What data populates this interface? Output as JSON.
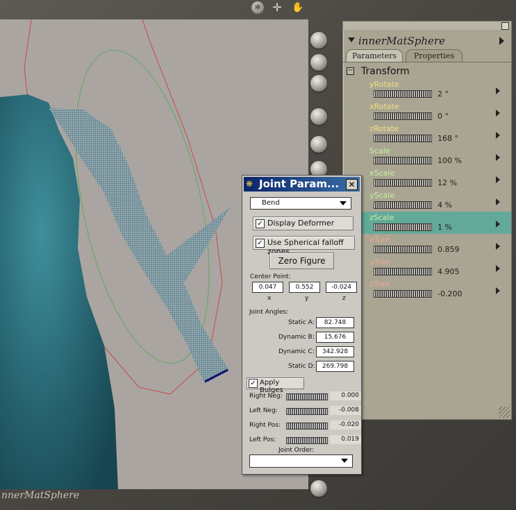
{
  "viewport": {
    "figure_label": "nnerMatSphere"
  },
  "toolbar": {
    "icons": [
      "camera-rotate-icon",
      "move-xyz-icon",
      "hand-icon"
    ]
  },
  "params_panel": {
    "title": "innerMatSphere",
    "tabs": [
      "Parameters",
      "Properties"
    ],
    "section": "Transform",
    "section_toggle": "−",
    "rows": [
      {
        "name": "yRotate",
        "value": "2 °",
        "color": "#f0e080"
      },
      {
        "name": "xRotate",
        "value": "0 °",
        "color": "#f0e080"
      },
      {
        "name": "zRotate",
        "value": "168 °",
        "color": "#f0e080"
      },
      {
        "name": "Scale",
        "value": "100 %",
        "color": "#c8f0a0"
      },
      {
        "name": "xScale",
        "value": "12 %",
        "color": "#c8f0a0"
      },
      {
        "name": "yScale",
        "value": "4 %",
        "color": "#c8f0a0"
      },
      {
        "name": "zScale",
        "value": "1 %",
        "color": "#c8f0a0",
        "selected": true
      },
      {
        "name": "xTran",
        "value": "0.859",
        "color": "#e8a890"
      },
      {
        "name": "yTran",
        "value": "4.905",
        "color": "#e8a890"
      },
      {
        "name": "zTran",
        "value": "-0.200",
        "color": "#e8a890"
      }
    ]
  },
  "joint_dialog": {
    "title": "Joint Param...",
    "close": "✕",
    "deformer_type": "Bend",
    "display_deformer": {
      "label": "Display Deformer",
      "checked": "✓"
    },
    "spherical_falloff": {
      "label": "Use Spherical falloff zones",
      "checked": "✓"
    },
    "zero_figure": "Zero Figure",
    "center_point": {
      "label": "Center Point:",
      "x": "0.047",
      "y": "0.552",
      "z": "-0.024",
      "x_label": "x",
      "y_label": "y",
      "z_label": "z"
    },
    "joint_angles": {
      "label": "Joint Angles:",
      "static_a": {
        "label": "Static A:",
        "value": "82.748"
      },
      "dynamic_b": {
        "label": "Dynamic B:",
        "value": "15.676"
      },
      "dynamic_c": {
        "label": "Dynamic C:",
        "value": "342.928"
      },
      "static_d": {
        "label": "Static D:",
        "value": "269.798"
      }
    },
    "apply_bulges": {
      "label": "Apply Bulges",
      "checked": "✓"
    },
    "bulges": [
      {
        "label": "Right Neg:",
        "value": "0.000"
      },
      {
        "label": "Left Neg:",
        "value": "-0.008"
      },
      {
        "label": "Right Pos:",
        "value": "-0.020"
      },
      {
        "label": "Left Pos:",
        "value": "0.019"
      }
    ],
    "joint_order_label": "Joint Order:",
    "joint_order_value": ""
  },
  "colors": {
    "figure": "#2b6f7c",
    "panel": "#aaa593",
    "selected_row": "#63a99a",
    "dialog_title": "#0a246a"
  }
}
